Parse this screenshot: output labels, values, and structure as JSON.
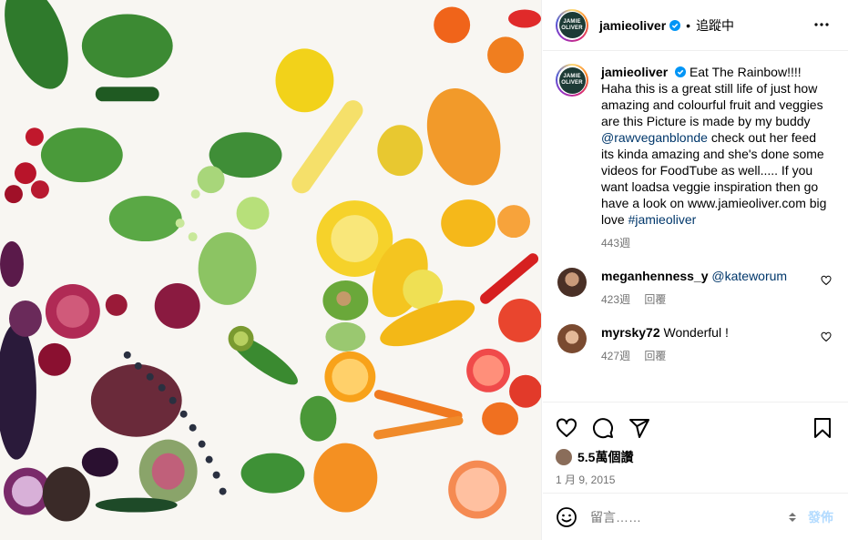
{
  "post": {
    "image_alt": "Rainbow arrangement of fruits and vegetables"
  },
  "header": {
    "avatar_logo_line1": "JAMIE",
    "avatar_logo_line2": "OLIVER",
    "username": "jamieoliver",
    "separator": "•",
    "follow_label": "追蹤中"
  },
  "caption": {
    "username": "jamieoliver",
    "text_part1": "Eat The Rainbow!!!! Haha this is a great still life of just how amazing and colourful fruit and veggies are this Picture is made by my buddy ",
    "mention": "@rawveganblonde",
    "text_part2": " check out her feed its kinda amazing and she's done some videos for FoodTube as well..... If you want loadsa veggie inspiration then go have a look on www.jamieoliver.com big love ",
    "hashtag": "#jamieoliver",
    "age": "443週"
  },
  "comments": [
    {
      "username": "meganhenness_y",
      "text": "@kateworum",
      "age": "423週",
      "reply": "回覆"
    },
    {
      "username": "myrsky72",
      "text": "Wonderful !",
      "age": "427週",
      "reply": "回覆"
    }
  ],
  "likes": {
    "count_label": "5.5萬個讚"
  },
  "date": "1 月 9, 2015",
  "composer": {
    "placeholder": "留言……",
    "post_label": "發佈"
  },
  "colors": {
    "link": "#00376b",
    "muted": "#737373",
    "post_disabled": "#b3dbff",
    "verified": "#0095f6"
  }
}
